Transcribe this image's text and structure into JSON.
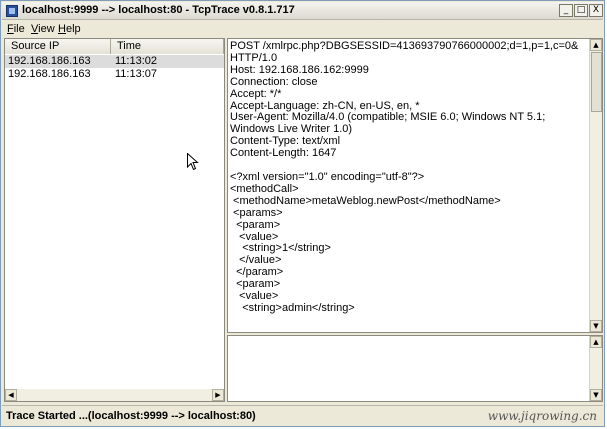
{
  "window": {
    "title": "localhost:9999 --> localhost:80 - TcpTrace v0.8.1.717",
    "buttons": {
      "minimize": "_",
      "maximize": "□",
      "close": "X"
    }
  },
  "menu": {
    "file": {
      "first": "F",
      "rest": "ile"
    },
    "view": {
      "first": "V",
      "rest": "iew"
    },
    "help": {
      "first": "H",
      "rest": "elp"
    }
  },
  "connections": {
    "columns": [
      "Source IP",
      "Time"
    ],
    "rows": [
      {
        "ip": "192.168.186.163",
        "time": "11:13:02",
        "selected": true
      },
      {
        "ip": "192.168.186.163",
        "time": "11:13:07",
        "selected": false
      }
    ]
  },
  "request": {
    "text": "POST /xmlrpc.php?DBGSESSID=413693790766000002;d=1,p=1,c=0&\nHTTP/1.0\nHost: 192.168.186.162:9999\nConnection: close\nAccept: */*\nAccept-Language: zh-CN, en-US, en, *\nUser-Agent: Mozilla/4.0 (compatible; MSIE 6.0; Windows NT 5.1;\nWindows Live Writer 1.0)\nContent-Type: text/xml\nContent-Length: 1647\n\n<?xml version=\"1.0\" encoding=\"utf-8\"?>\n<methodCall>\n <methodName>metaWeblog.newPost</methodName>\n <params>\n  <param>\n   <value>\n    <string>1</string>\n   </value>\n  </param>\n  <param>\n   <value>\n    <string>admin</string>"
  },
  "response": {
    "text": ""
  },
  "status": {
    "text": "Trace Started ...(localhost:9999 --> localhost:80)",
    "watermark": "www.jiqrowing.cn"
  },
  "icons": {
    "app": "tcptrace-app-icon",
    "cursor": "mouse-pointer-icon"
  },
  "colors": {
    "selection": "#dcdcdc",
    "window_bg": "#ece9d8"
  }
}
